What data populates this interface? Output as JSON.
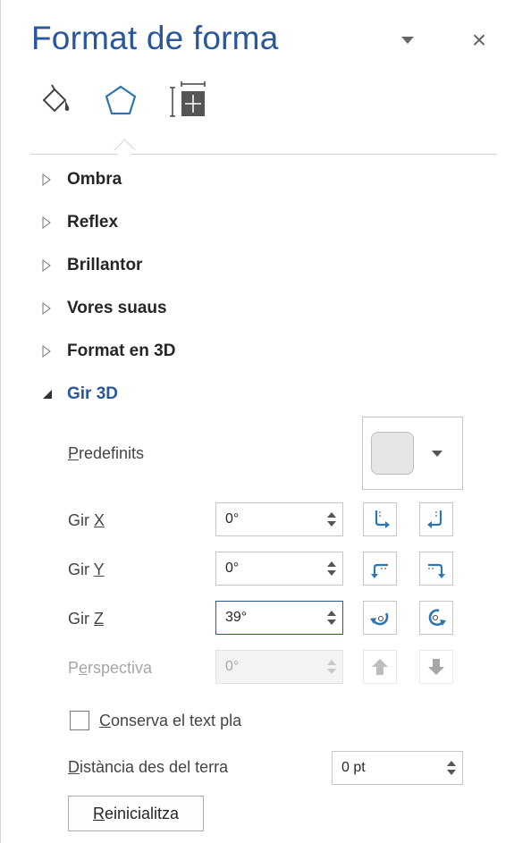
{
  "pane": {
    "title": "Format de forma",
    "close_glyph": "×",
    "tabs": [
      {
        "icon": "fill-bucket-icon",
        "active": false
      },
      {
        "icon": "effects-pentagon-icon",
        "active": true
      },
      {
        "icon": "size-properties-icon",
        "active": false
      }
    ]
  },
  "sections": {
    "ombra": "Ombra",
    "reflex": "Reflex",
    "brillantor": "Brillantor",
    "vores": "Vores suaus",
    "format3d": "Format en 3D",
    "gir3d": "Gir 3D"
  },
  "rotation": {
    "presets": {
      "label_first": "P",
      "label_rest": "redefinits"
    },
    "x": {
      "label_pre": "Gir ",
      "label_key": "X",
      "value": "0°"
    },
    "y": {
      "label_pre": "Gir ",
      "label_key": "Y",
      "value": "0°"
    },
    "z": {
      "label_pre": "Gir ",
      "label_key": "Z",
      "value": "39°"
    },
    "perspective": {
      "label_pre": "P",
      "label_key": "e",
      "label_post": "rspectiva",
      "value": "0°"
    },
    "keep_text_flat": {
      "label_key": "C",
      "label_rest": "onserva el text pla",
      "checked": false
    },
    "distance": {
      "label_key": "D",
      "label_rest": "istància des del terra",
      "value": "0 pt"
    },
    "reset": {
      "label_key": "R",
      "label_rest": "einicialitza"
    }
  },
  "colors": {
    "accent": "#2b579a",
    "rotate_icon": "#2e75b6"
  }
}
